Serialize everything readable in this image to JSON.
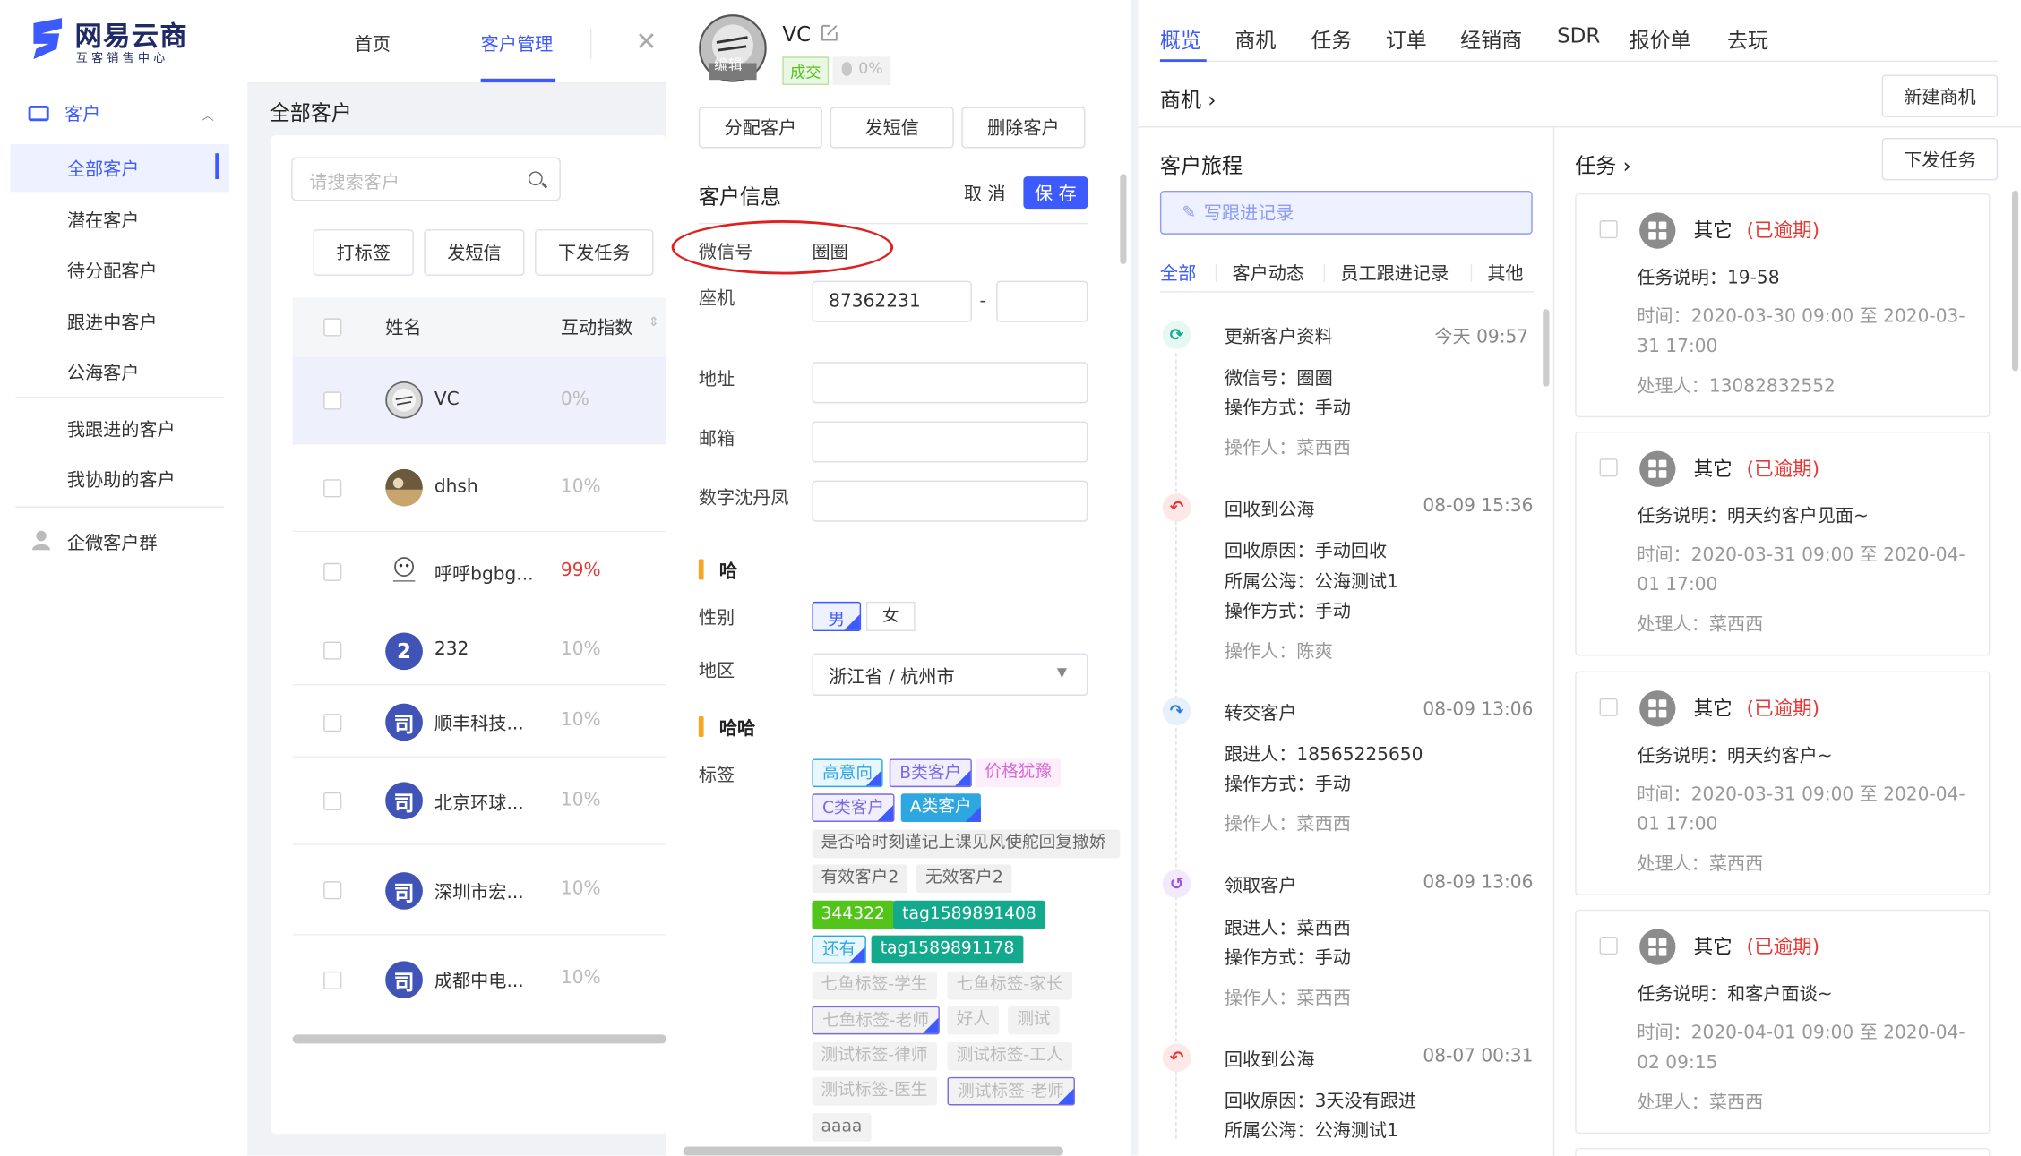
{
  "brand": {
    "title": "网易云商",
    "subtitle": "互客销售中心"
  },
  "sidebar": {
    "group_label": "客户",
    "items": [
      "全部客户",
      "潜在客户",
      "待分配客户",
      "跟进中客户",
      "公海客户"
    ],
    "items2": [
      "我跟进的客户",
      "我协助的客户"
    ],
    "wecom_label": "企微客户群"
  },
  "topnav": {
    "home": "首页",
    "customers": "客户管理"
  },
  "list": {
    "page_title": "全部客户",
    "search_placeholder": "请搜索客户",
    "actions": [
      "打标签",
      "发短信",
      "下发任务"
    ],
    "col_name": "姓名",
    "col_index": "互动指数",
    "rows": [
      {
        "name": "VC",
        "pct": "0%"
      },
      {
        "name": "dhsh",
        "pct": "10%"
      },
      {
        "name": "呼呼bgbg...",
        "pct": "99%"
      },
      {
        "name": "232",
        "pct": "10%",
        "avatar_text": "2"
      },
      {
        "name": "顺丰科技...",
        "pct": "10%",
        "avatar_text": "司"
      },
      {
        "name": "北京环球...",
        "pct": "10%",
        "avatar_text": "司"
      },
      {
        "name": "深圳市宏...",
        "pct": "10%",
        "avatar_text": "司"
      },
      {
        "name": "成都中电...",
        "pct": "10%",
        "avatar_text": "司"
      }
    ]
  },
  "detail": {
    "name": "VC",
    "avatar_text": "编辑",
    "status": "成交",
    "progress": "0%",
    "buttons": [
      "分配客户",
      "发短信",
      "删除客户"
    ],
    "section_title": "客户信息",
    "cancel": "取 消",
    "save": "保 存",
    "fields": {
      "wechat_label": "微信号",
      "wechat_value": "圈圈",
      "phone_label": "座机",
      "phone_value": "87362231",
      "phone_sep": "-",
      "address_label": "地址",
      "email_label": "邮箱",
      "digit_label": "数字沈丹凤"
    },
    "group1": "哈",
    "gender_label": "性别",
    "male": "男",
    "female": "女",
    "region_label": "地区",
    "region_value": "浙江省 / 杭州市",
    "group2": "哈哈",
    "tags_label": "标签",
    "tags": [
      "高意向",
      "B类客户",
      "价格犹豫",
      "C类客户",
      "A类客户",
      "是否哈时刻谨记上课见风使舵回复撒娇",
      "有效客户2",
      "无效客户2",
      "344322",
      "tag1589891408",
      "还有",
      "tag1589891178",
      "七鱼标签-学生",
      "七鱼标签-家长",
      "七鱼标签-老师",
      "好人",
      "测试",
      "测试标签-律师",
      "测试标签-工人",
      "测试标签-医生",
      "测试标签-老师",
      "aaaa"
    ]
  },
  "right": {
    "tabs": [
      "概览",
      "商机",
      "任务",
      "订单",
      "经销商",
      "SDR",
      "报价单",
      "去玩"
    ],
    "opportunity_title": "商机 ›",
    "new_opportunity": "新建商机",
    "journey_title": "客户旅程",
    "write_record": "写跟进记录",
    "sub_tabs": [
      "全部",
      "客户动态",
      "员工跟进记录",
      "其他"
    ],
    "events": [
      {
        "title": "更新客户资料",
        "time": "今天 09:57",
        "lines": [
          "微信号：圈圈",
          "操作方式：手动"
        ],
        "op": "操作人：菜西西"
      },
      {
        "title": "回收到公海",
        "time": "08-09 15:36",
        "lines": [
          "回收原因：手动回收",
          "所属公海：公海测试1",
          "操作方式：手动"
        ],
        "op": "操作人：陈爽"
      },
      {
        "title": "转交客户",
        "time": "08-09 13:06",
        "lines": [
          "跟进人：18565225650",
          "操作方式：手动"
        ],
        "op": "操作人：菜西西"
      },
      {
        "title": "领取客户",
        "time": "08-09 13:06",
        "lines": [
          "跟进人：菜西西",
          "操作方式：手动"
        ],
        "op": "操作人：菜西西"
      },
      {
        "title": "回收到公海",
        "time": "08-07 00:31",
        "lines": [
          "回收原因：3天没有跟进",
          "所属公海：公海测试1"
        ],
        "op": ""
      }
    ],
    "task_title": "任务 ›",
    "send_task": "下发任务",
    "tasks": [
      {
        "type": "其它",
        "overdue": "(已逾期)",
        "desc": "任务说明：19-58",
        "time": "时间：2020-03-30 09:00 至 2020-03-31 17:00",
        "owner": "处理人：13082832552"
      },
      {
        "type": "其它",
        "overdue": "(已逾期)",
        "desc": "任务说明：明天约客户见面~",
        "time": "时间：2020-03-31 09:00 至 2020-04-01 17:00",
        "owner": "处理人：菜西西"
      },
      {
        "type": "其它",
        "overdue": "(已逾期)",
        "desc": "任务说明：明天约客户~",
        "time": "时间：2020-03-31 09:00 至 2020-04-01 17:00",
        "owner": "处理人：菜西西"
      },
      {
        "type": "其它",
        "overdue": "(已逾期)",
        "desc": "任务说明：和客户面谈~",
        "time": "时间：2020-04-01 09:00 至 2020-04-02 09:15",
        "owner": "处理人：菜西西"
      }
    ]
  },
  "colors": {
    "accent": "#3d5afe",
    "overdue": "#e53935",
    "annotation": "#e02020",
    "success": "#52c41a"
  }
}
